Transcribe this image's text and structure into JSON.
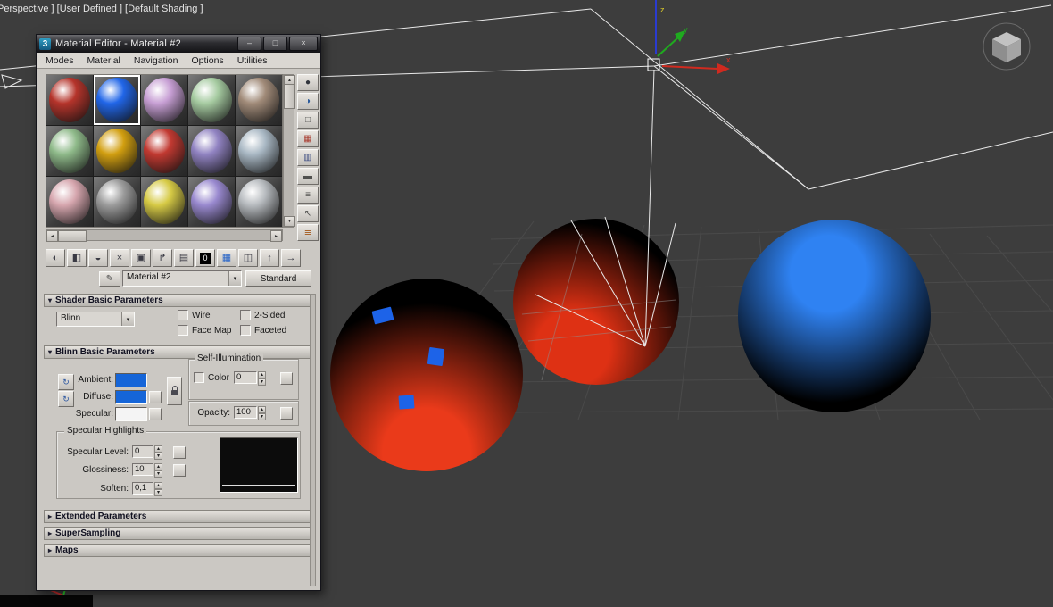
{
  "viewport_label": "Perspective ] [User Defined ] [Default Shading ]",
  "window": {
    "title": "Material Editor - Material #2"
  },
  "icons": {
    "app": "3",
    "minimize": "–",
    "maximize": "□",
    "close": "×",
    "dropdown_arrow": "▾",
    "spinner_up": "▴",
    "spinner_down": "▾",
    "scroll_up": "▲",
    "scroll_down": "▼",
    "scroll_left": "◄",
    "scroll_right": "►",
    "eyedropper": "✎",
    "lock_toggle": "↻"
  },
  "menu": {
    "items": [
      "Modes",
      "Material",
      "Navigation",
      "Options",
      "Utilities"
    ]
  },
  "slots": {
    "selected_index": 1,
    "spheres": [
      {
        "name": "red",
        "color": "#b5342b"
      },
      {
        "name": "blue",
        "color": "#2166e8"
      },
      {
        "name": "lilac",
        "color": "#c79fd4"
      },
      {
        "name": "pale-green",
        "color": "#a6cba1"
      },
      {
        "name": "tan",
        "color": "#a18b79"
      },
      {
        "name": "green",
        "color": "#8fba8a"
      },
      {
        "name": "gold",
        "color": "#d29f10"
      },
      {
        "name": "red",
        "color": "#c13931"
      },
      {
        "name": "violet",
        "color": "#9183c2"
      },
      {
        "name": "blue-gray",
        "color": "#a9b8c4"
      },
      {
        "name": "pink",
        "color": "#d6a6ae"
      },
      {
        "name": "gray",
        "color": "#9c9c9c"
      },
      {
        "name": "yellow",
        "color": "#d6ca45"
      },
      {
        "name": "purple",
        "color": "#9989cf"
      },
      {
        "name": "light-gray",
        "color": "#b7bbbf"
      }
    ]
  },
  "side_toolbar": {
    "items": [
      {
        "name": "sample-type",
        "glyph": "●",
        "color": "#30343c"
      },
      {
        "name": "backlight",
        "glyph": "◑",
        "color": "#2a5a9c"
      },
      {
        "name": "background",
        "glyph": "□",
        "color": "#50504e"
      },
      {
        "name": "sample-uv-tiling",
        "glyph": "▦",
        "color": "#a83a2e"
      },
      {
        "name": "video-color-check",
        "glyph": "▥",
        "color": "#3a4a80"
      },
      {
        "name": "make-preview",
        "glyph": "▬",
        "color": "#50504e"
      },
      {
        "name": "options",
        "glyph": "≡",
        "color": "#50504e"
      },
      {
        "name": "select-by-material",
        "glyph": "↖",
        "color": "#50504e"
      },
      {
        "name": "material-map-navigator",
        "glyph": "≣",
        "color": "#a8652e"
      }
    ]
  },
  "toolbar": {
    "items": [
      {
        "name": "get-material",
        "glyph": "◐"
      },
      {
        "name": "put-material-to-scene",
        "glyph": "◧"
      },
      {
        "name": "assign-material-to-selection",
        "glyph": "◒"
      },
      {
        "name": "reset-map-mtl",
        "glyph": "×"
      },
      {
        "name": "make-material-copy",
        "glyph": "▣"
      },
      {
        "name": "make-unique",
        "glyph": "↱"
      },
      {
        "name": "put-to-library",
        "glyph": "▤"
      },
      {
        "name": "material-id-channel",
        "glyph": "0"
      },
      {
        "name": "show-shaded-material-in-viewport",
        "glyph": "▦"
      },
      {
        "name": "show-end-result",
        "glyph": "◫"
      },
      {
        "name": "go-to-parent",
        "glyph": "↑"
      },
      {
        "name": "go-forward-to-sibling",
        "glyph": "→"
      }
    ]
  },
  "material_bar": {
    "name": "Material #2",
    "type_button": "Standard"
  },
  "rollouts": {
    "shader": {
      "arrow": "▾",
      "title": "Shader Basic Parameters"
    },
    "blinn": {
      "arrow": "▾",
      "title": "Blinn Basic Parameters"
    },
    "extended": {
      "arrow": "▸",
      "title": "Extended Parameters"
    },
    "supersampling": {
      "arrow": "▸",
      "title": "SuperSampling"
    },
    "maps": {
      "arrow": "▸",
      "title": "Maps"
    }
  },
  "shader_params": {
    "shader_value": "Blinn",
    "checks": [
      "Wire",
      "2-Sided",
      "Face Map",
      "Faceted"
    ]
  },
  "blinn_params": {
    "labels": {
      "ambient": "Ambient:",
      "diffuse": "Diffuse:",
      "specular": "Specular:"
    },
    "swatches": {
      "ambient": "#1565d8",
      "diffuse": "#1565d8",
      "specular": "#f4f4f4"
    },
    "self_illumination": {
      "title": "Self-Illumination",
      "color_check": "Color",
      "value": "0"
    },
    "opacity": {
      "label": "Opacity:",
      "value": "100"
    },
    "specular_highlights": {
      "title": "Specular Highlights",
      "specular_level": {
        "label": "Specular Level:",
        "value": "0"
      },
      "glossiness": {
        "label": "Glossiness:",
        "value": "10"
      },
      "soften": {
        "label": "Soften:",
        "value": "0,1"
      }
    }
  },
  "scene": {
    "spheres": [
      {
        "name": "sphere-red-left",
        "base": "#ea3a1a",
        "shade": "#000000",
        "light": "bottom"
      },
      {
        "name": "sphere-red-middle",
        "base": "#de3114",
        "shade": "#000000",
        "light": "bottom-left"
      },
      {
        "name": "sphere-blue-right",
        "base": "#2f82f2",
        "shade": "#000000",
        "light": "top"
      }
    ],
    "chip_color": "#1d63e8"
  }
}
